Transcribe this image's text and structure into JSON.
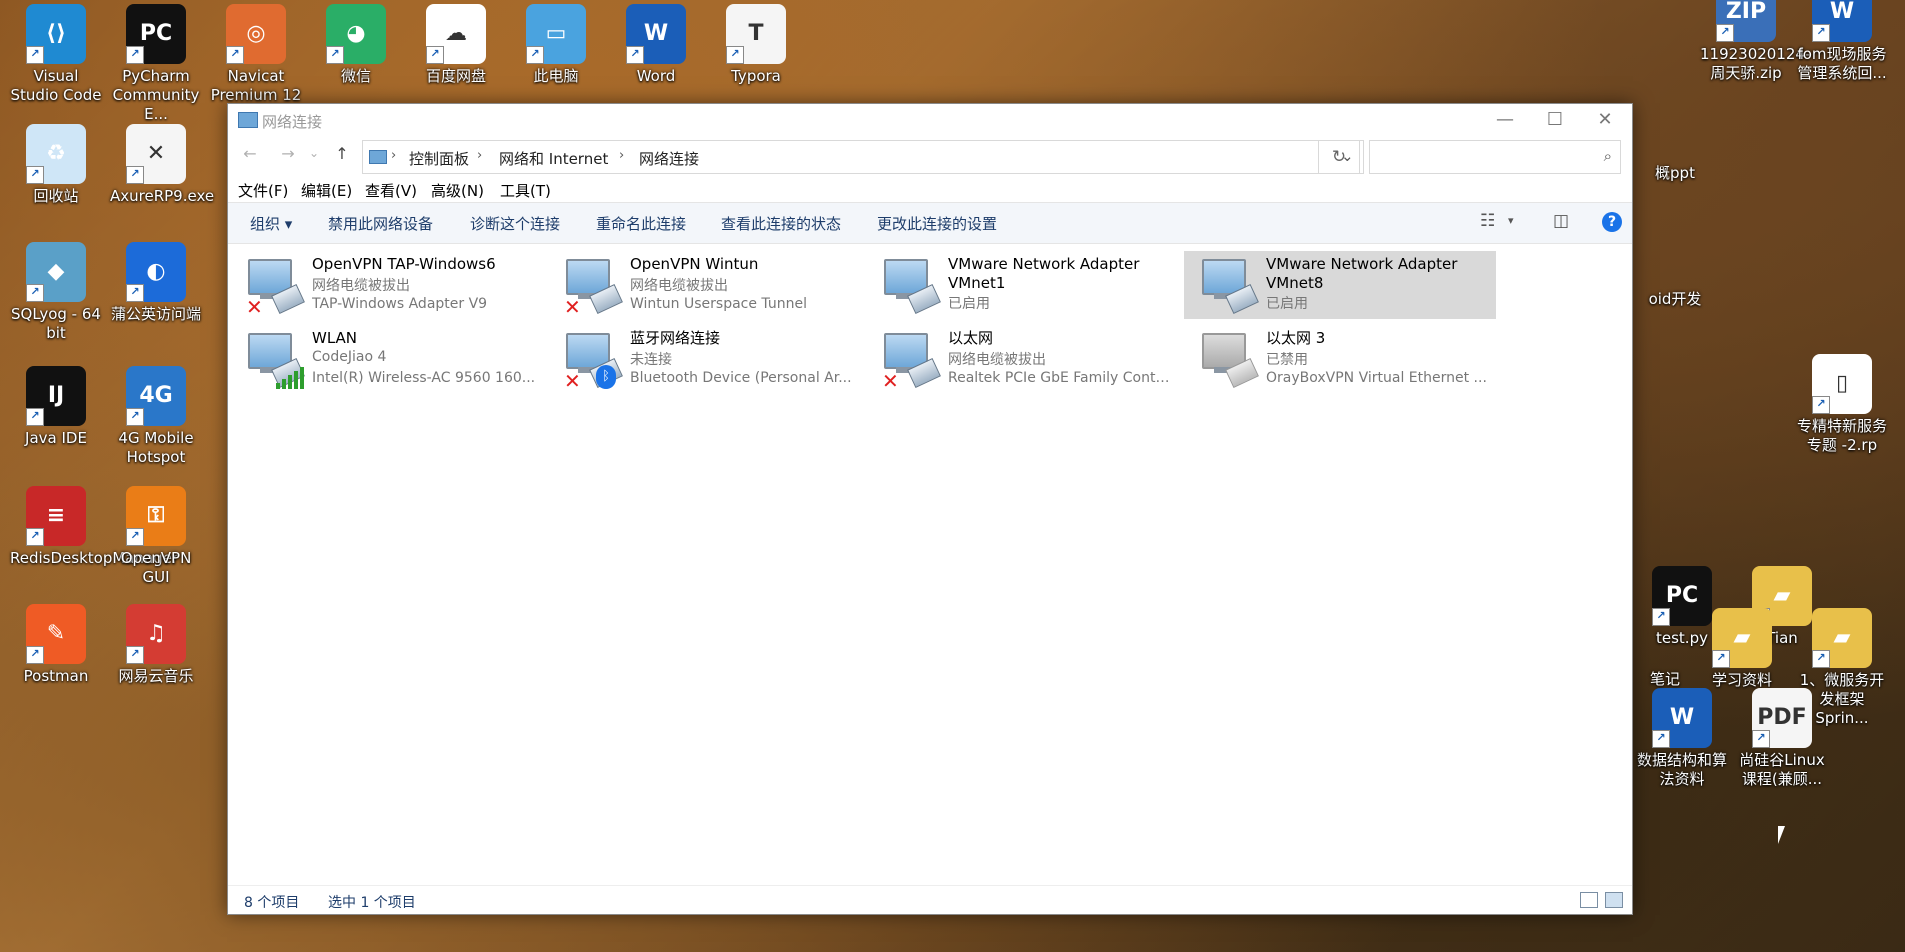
{
  "desktop": {
    "icons": [
      {
        "id": "vscode",
        "label": "Visual Studio Code",
        "color": "#1f8ad2",
        "glyph": "⟨⟩"
      },
      {
        "id": "pycharm",
        "label": "PyCharm Community E...",
        "color": "#111111",
        "glyph": "PC"
      },
      {
        "id": "navicat",
        "label": "Navicat Premium 12",
        "color": "#e06b30",
        "glyph": "◎"
      },
      {
        "id": "wechat",
        "label": "微信",
        "color": "#2aae67",
        "glyph": "◕"
      },
      {
        "id": "baidu",
        "label": "百度网盘",
        "color": "#ffffff",
        "glyph": "☁"
      },
      {
        "id": "thispc",
        "label": "此电脑",
        "color": "#4aa3df",
        "glyph": "▭"
      },
      {
        "id": "word",
        "label": "Word",
        "color": "#1b5eb8",
        "glyph": "W"
      },
      {
        "id": "typora",
        "label": "Typora",
        "color": "#f5f5f5",
        "glyph": "T"
      },
      {
        "id": "recycle",
        "label": "回收站",
        "color": "#cfe6f7",
        "glyph": "♻"
      },
      {
        "id": "axure",
        "label": "AxureRP9.exe",
        "color": "#f5f5f5",
        "glyph": "✕"
      },
      {
        "id": "sqlyog",
        "label": "SQLyog - 64 bit",
        "color": "#5aa0c8",
        "glyph": "◆"
      },
      {
        "id": "pupu",
        "label": "蒲公英访问端",
        "color": "#1c6bd9",
        "glyph": "◐"
      },
      {
        "id": "javaide",
        "label": "Java IDE",
        "color": "#111111",
        "glyph": "IJ"
      },
      {
        "id": "hotspot",
        "label": "4G Mobile Hotspot",
        "color": "#2a77c9",
        "glyph": "4G"
      },
      {
        "id": "redis",
        "label": "RedisDesktopManager",
        "color": "#c82828",
        "glyph": "≡"
      },
      {
        "id": "openvpngui",
        "label": "OpenVPN GUI",
        "color": "#ea7d17",
        "glyph": "⚿"
      },
      {
        "id": "postman",
        "label": "Postman",
        "color": "#ef5b25",
        "glyph": "✎"
      },
      {
        "id": "netease",
        "label": "网易云音乐",
        "color": "#d43c33",
        "glyph": "♫"
      },
      {
        "id": "zipfile",
        "label": "11923020124-周天骄.zip",
        "color": "#3a6fb8",
        "glyph": "ZIP"
      },
      {
        "id": "fomdoc",
        "label": "fom现场服务管理系统回...",
        "color": "#1b5eb8",
        "glyph": "W"
      },
      {
        "id": "rpfile",
        "label": "专精特新服务专题 -2.rp",
        "color": "#ffffff",
        "glyph": "▯"
      },
      {
        "id": "testpy",
        "label": "test.py",
        "color": "#111111",
        "glyph": "PC"
      },
      {
        "id": "tian",
        "label": "Tian",
        "color": "#e8c04a",
        "glyph": "▰"
      },
      {
        "id": "study",
        "label": "学习资料",
        "color": "#e8c04a",
        "glyph": "▰"
      },
      {
        "id": "micro",
        "label": "1、微服务开发框架Sprin...",
        "color": "#e8c04a",
        "glyph": "▰"
      },
      {
        "id": "dsdoc",
        "label": "数据结构和算法资料",
        "color": "#1b5eb8",
        "glyph": "W"
      },
      {
        "id": "linuxpdf",
        "label": "尚硅谷Linux课程(兼顾...",
        "color": "#f5f5f5",
        "glyph": "PDF"
      }
    ],
    "partial_labels": {
      "ppt": "概ppt",
      "android": "oid开发",
      "notes": "笔记"
    }
  },
  "window": {
    "title": "网络连接",
    "controls": {
      "minimize": "—",
      "maximize": "☐",
      "close": "✕"
    },
    "nav": {
      "back": "←",
      "forward": "→",
      "recent": "⌄",
      "up": "↑"
    },
    "breadcrumb": [
      "控制面板",
      "网络和 Internet",
      "网络连接"
    ],
    "search_placeholder": "",
    "menu": [
      "文件(F)",
      "编辑(E)",
      "查看(V)",
      "高级(N)",
      "工具(T)"
    ],
    "commands": {
      "organize": "组织 ▾",
      "disable": "禁用此网络设备",
      "diagnose": "诊断这个连接",
      "rename": "重命名此连接",
      "status": "查看此连接的状态",
      "settings": "更改此连接的设置"
    },
    "connections": [
      {
        "name": "OpenVPN TAP-Windows6",
        "status": "网络电缆被拔出",
        "device": "TAP-Windows Adapter V9",
        "badge": "x"
      },
      {
        "name": "OpenVPN Wintun",
        "status": "网络电缆被拔出",
        "device": "Wintun Userspace Tunnel",
        "badge": "x"
      },
      {
        "name": "VMware Network Adapter VMnet1",
        "status": "已启用",
        "device": "",
        "badge": "none"
      },
      {
        "name": "VMware Network Adapter VMnet8",
        "status": "已启用",
        "device": "",
        "badge": "none",
        "selected": true
      },
      {
        "name": "WLAN",
        "status": "CodeJiao 4",
        "device": "Intel(R) Wireless-AC 9560 160...",
        "badge": "wifi"
      },
      {
        "name": "蓝牙网络连接",
        "status": "未连接",
        "device": "Bluetooth Device (Personal Ar...",
        "badge": "bluetooth"
      },
      {
        "name": "以太网",
        "status": "网络电缆被拔出",
        "device": "Realtek PCIe GbE Family Contr...",
        "badge": "x"
      },
      {
        "name": "以太网 3",
        "status": "已禁用",
        "device": "OrayBoxVPN Virtual Ethernet ...",
        "badge": "disabled"
      }
    ],
    "statusbar": {
      "count": "8 个项目",
      "selected": "选中 1 个项目"
    }
  }
}
